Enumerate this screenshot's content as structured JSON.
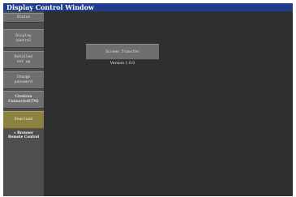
{
  "window": {
    "title": "Display Control Window"
  },
  "sidebar": {
    "items": [
      {
        "label": "Status"
      },
      {
        "label": "Display\ncontrol"
      },
      {
        "label": "Detailed\nset up"
      },
      {
        "label": "Change\npassword"
      },
      {
        "label": "Crestron\nConnected(TM)"
      },
      {
        "label": "Download",
        "active": true
      }
    ],
    "link": {
      "label": "» Browser\nRemote Control"
    }
  },
  "main": {
    "button_label": "Screen Transfer",
    "version": "Version 1.0.0"
  },
  "colors": {
    "title_bar": "#1e3c8c",
    "background": "#2f2f2f",
    "sidebar": "#4e4e4e",
    "button": "#6f6f6f",
    "active_button": "#8b8240"
  }
}
